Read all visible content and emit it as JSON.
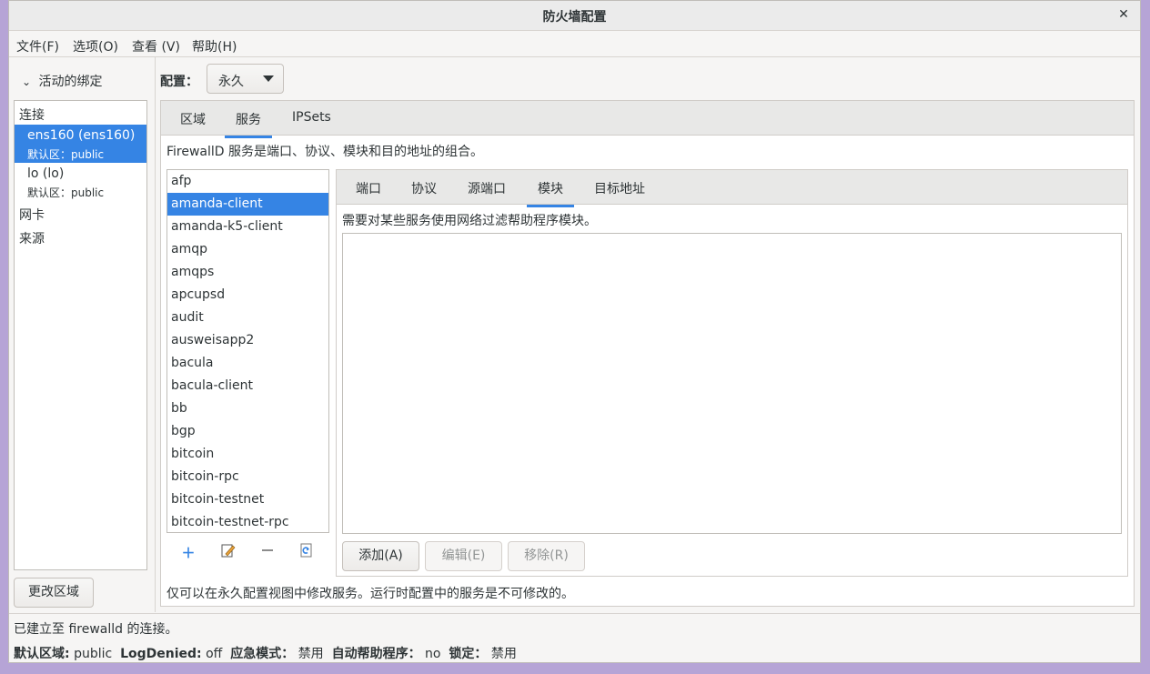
{
  "window": {
    "title": "防火墙配置"
  },
  "menu": [
    "文件(F)",
    "选项(O)",
    "查看 (V)",
    "帮助(H)"
  ],
  "bindings": {
    "toggle_label": "活动的绑定",
    "connections_header": "连接",
    "connections": [
      {
        "name": "ens160 (ens160)",
        "zone": "默认区：public",
        "selected": true
      },
      {
        "name": "lo (lo)",
        "zone": "默认区：public",
        "selected": false
      }
    ],
    "interfaces_header": "网卡",
    "sources_header": "来源",
    "change_zone_button": "更改区域"
  },
  "config": {
    "label": "配置：",
    "value": "永久"
  },
  "main_tabs": [
    "区域",
    "服务",
    "IPSets"
  ],
  "services": {
    "description": "FirewallD 服务是端口、协议、模块和目的地址的组合。",
    "list": [
      "afp",
      "amanda-client",
      "amanda-k5-client",
      "amqp",
      "amqps",
      "apcupsd",
      "audit",
      "ausweisapp2",
      "bacula",
      "bacula-client",
      "bb",
      "bgp",
      "bitcoin",
      "bitcoin-rpc",
      "bitcoin-testnet",
      "bitcoin-testnet-rpc"
    ],
    "selected": "amanda-client",
    "tools": [
      "add-icon",
      "edit-icon",
      "remove-icon",
      "reload-icon"
    ],
    "sub_tabs": [
      "端口",
      "协议",
      "源端口",
      "模块",
      "目标地址"
    ],
    "modules_description": "需要对某些服务使用网络过滤帮助程序模块。",
    "buttons": {
      "add": "添加(A)",
      "edit": "编辑(E)",
      "remove": "移除(R)"
    },
    "footer_note": "仅可以在永久配置视图中修改服务。运行时配置中的服务是不可修改的。"
  },
  "status": {
    "connection": "已建立至 firewalld 的连接。",
    "default_zone_label": "默认区域:",
    "default_zone_value": "public",
    "log_denied_label": "LogDenied:",
    "log_denied_value": "off",
    "panic_label": "应急模式：",
    "panic_value": "禁用",
    "helpers_label": "自动帮助程序：",
    "helpers_value": "no",
    "lockdown_label": "锁定：",
    "lockdown_value": "禁用"
  },
  "colors": {
    "accent": "#3584e4",
    "window_bg": "#f6f5f4",
    "desktop_bg": "#b6a4d6"
  }
}
